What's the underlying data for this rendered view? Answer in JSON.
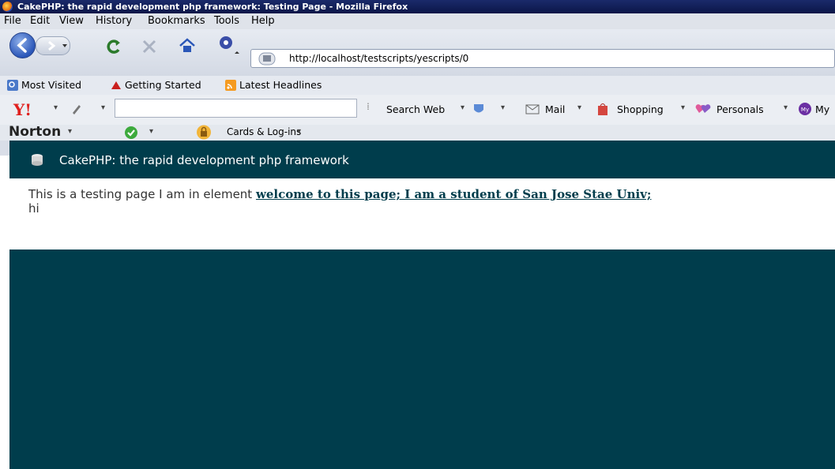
{
  "window": {
    "title": "CakePHP: the rapid development php framework: Testing Page - Mozilla Firefox"
  },
  "menu": {
    "items": [
      "File",
      "Edit",
      "View",
      "History",
      "Bookmarks",
      "Tools",
      "Help"
    ]
  },
  "navigation": {
    "url": "http://localhost/testscripts/yescripts/0"
  },
  "bookmarks": {
    "items": [
      "Most Visited",
      "Getting Started",
      "Latest Headlines"
    ]
  },
  "yahoo_toolbar": {
    "search_web": "Search Web",
    "mail": "Mail",
    "shopping": "Shopping",
    "personals": "Personals",
    "my": "My"
  },
  "norton_toolbar": {
    "brand": "Norton",
    "cards": "Cards & Log-ins"
  },
  "page": {
    "header_title": "CakePHP: the rapid development php framework",
    "body_text": "This is a testing page I am in element ",
    "link_text": "welcome to this page; I am a student of San Jose Stae Univ;",
    "line2": "hi"
  },
  "colors": {
    "header_bg": "#003d4c",
    "footer_bg": "#003d4c",
    "title_bar": "#0b1648"
  }
}
